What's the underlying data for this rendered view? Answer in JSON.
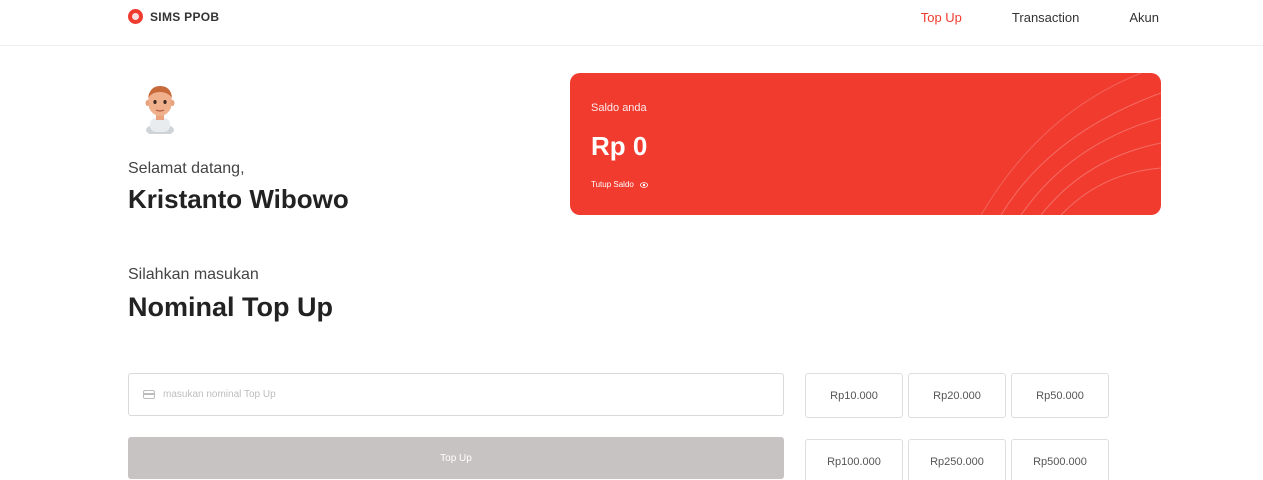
{
  "brand": {
    "name": "SIMS PPOB",
    "logo_icon": "brand-logo-icon",
    "color": "#f13b2f"
  },
  "nav": {
    "items": [
      {
        "label": "Top Up",
        "active": true
      },
      {
        "label": "Transaction",
        "active": false
      },
      {
        "label": "Akun",
        "active": false
      }
    ]
  },
  "profile": {
    "avatar_icon": "avatar-icon",
    "greeting": "Selamat datang,",
    "name": "Kristanto Wibowo"
  },
  "balance": {
    "label": "Saldo anda",
    "amount": "Rp 0",
    "toggle_label": "Tutup Saldo",
    "toggle_icon": "eye-icon",
    "card_color": "#f13b2f"
  },
  "topup": {
    "subtitle": "Silahkan masukan",
    "title": "Nominal Top Up",
    "input_placeholder": "masukan nominal Top Up",
    "input_value": "",
    "input_icon": "card-icon",
    "button_label": "Top Up",
    "button_color": "#c8c3c3",
    "presets": [
      "Rp10.000",
      "Rp20.000",
      "Rp50.000",
      "Rp100.000",
      "Rp250.000",
      "Rp500.000"
    ]
  }
}
